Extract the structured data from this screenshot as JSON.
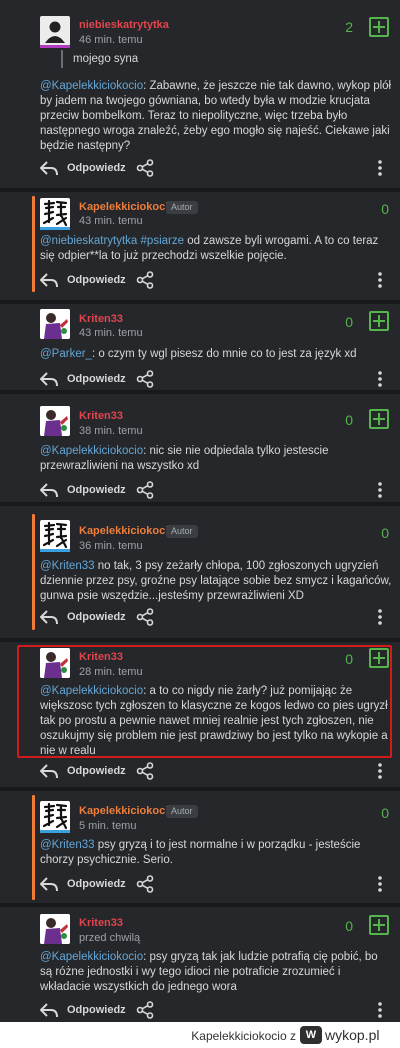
{
  "colors": {
    "background": "#25272a",
    "separator": "#18191b",
    "accent_orange": "#ef7d3a",
    "username_red": "#e2454d",
    "mention_blue": "#64a7d6",
    "vote_green": "#54b54b",
    "highlight_red": "#d31b1b"
  },
  "actions": {
    "reply_label": "Odpowiedz",
    "author_badge": "Autor"
  },
  "comments": [
    {
      "username": "niebieskatrytytka",
      "time": "46 min. temu",
      "votes": "2",
      "quote": "mojego syna",
      "mention": "@Kapelekkiciokocio",
      "text": ": Zabawne, że jeszcze nie tak dawno, wykop plół by jadem na twojego gówniana, bo wtedy była w modzie krucjata przeciw bombelkom. Teraz to niepolityczne, więc trzeba było następnego wroga znaleźć, żeby ego mogło się najeść. Ciekawe jaki będzie następny?"
    },
    {
      "username": "Kapelekkiciokocio",
      "time": "43 min. temu",
      "votes": "0",
      "mention": "@niebieskatrytytka",
      "tag": "#psiarze",
      "text": " od zawsze byli wrogami. A to co teraz się odpier**la to już przechodzi wszelkie pojęcie."
    },
    {
      "username": "Kriten33",
      "time": "43 min. temu",
      "votes": "0",
      "mention": "@Parker_",
      "text": ": o czym ty wgl pisesz do mnie co to jest za język xd"
    },
    {
      "username": "Kriten33",
      "time": "38 min. temu",
      "votes": "0",
      "mention": "@Kapelekkiciokocio",
      "text": ": nic sie nie odpiedala tylko jestescie przewrazliwieni na wszystko xd"
    },
    {
      "username": "Kapelekkiciokocio",
      "time": "36 min. temu",
      "votes": "0",
      "mention": "@Kriten33",
      "text": " no tak, 3 psy zeżarły chłopa, 100 zgłoszonych ugryzień dziennie przez psy, groźne psy latające sobie bez smycz i kagańców, gunwa psie wszędzie...jesteśmy przewrażliwieni XD"
    },
    {
      "username": "Kriten33",
      "time": "28 min. temu",
      "votes": "0",
      "mention": "@Kapelekkiciokocio",
      "text": ": a to co nigdy nie żarły? już pomijając że większosc tych zgłoszen to klasyczne ze kogos ledwo co pies ugryzł tak po prostu a pewnie nawet mniej realnie jest tych zgłoszen, nie oszukujmy się problem nie jest prawdziwy bo jest tylko na wykopie a nie w realu"
    },
    {
      "username": "Kapelekkiciokocio",
      "time": "5 min. temu",
      "votes": "0",
      "mention": "@Kriten33",
      "text": " psy gryzą i to jest normalne i w porządku - jesteście chorzy psychicznie. Serio."
    },
    {
      "username": "Kriten33",
      "time": "przed chwilą",
      "votes": "0",
      "mention": "@Kapelekkiciokocio",
      "text": ": psy gryzą tak jak ludzie potrafią cię pobić, bo są różne jednostki i wy tego idioci nie potraficie zrozumieć i wkładacie wszystkich do jednego wora"
    }
  ],
  "footer": {
    "author": "Kapelekkiciokocio",
    "suffix": "z",
    "site": "wykop.pl",
    "logo_text": "W"
  }
}
